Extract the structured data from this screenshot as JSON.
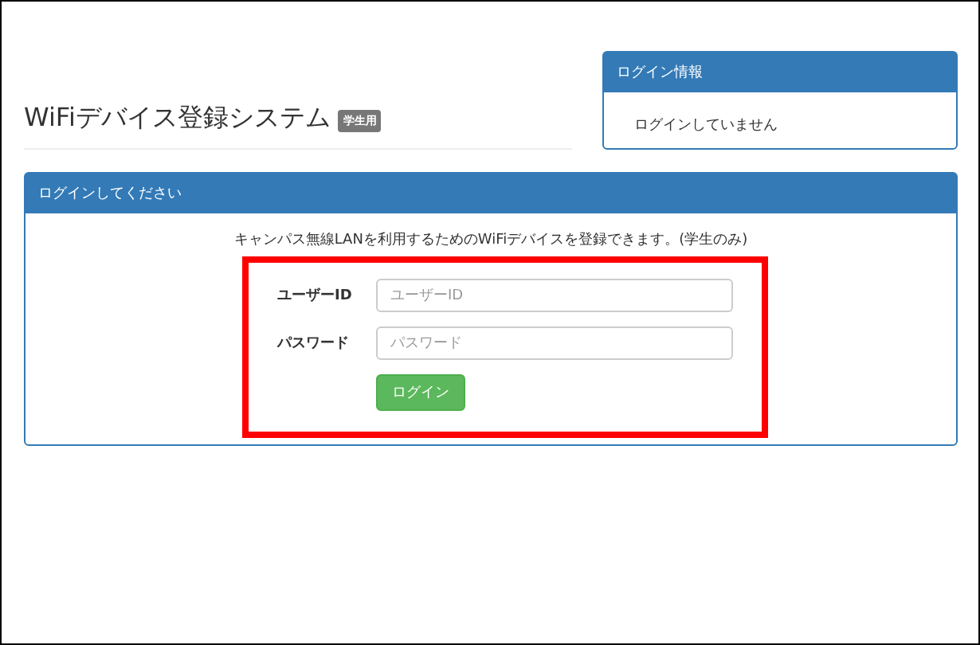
{
  "header": {
    "title": "WiFiデバイス登録システム",
    "badge": "学生用"
  },
  "login_info": {
    "title": "ログイン情報",
    "status": "ログインしていません"
  },
  "login_panel": {
    "title": "ログインしてください",
    "description": "キャンパス無線LANを利用するためのWiFiデバイスを登録できます。(学生のみ)",
    "fields": [
      {
        "label": "ユーザーID",
        "placeholder": "ユーザーID"
      },
      {
        "label": "パスワード",
        "placeholder": "パスワード"
      }
    ],
    "button": "ログイン",
    "highlighted": true
  }
}
